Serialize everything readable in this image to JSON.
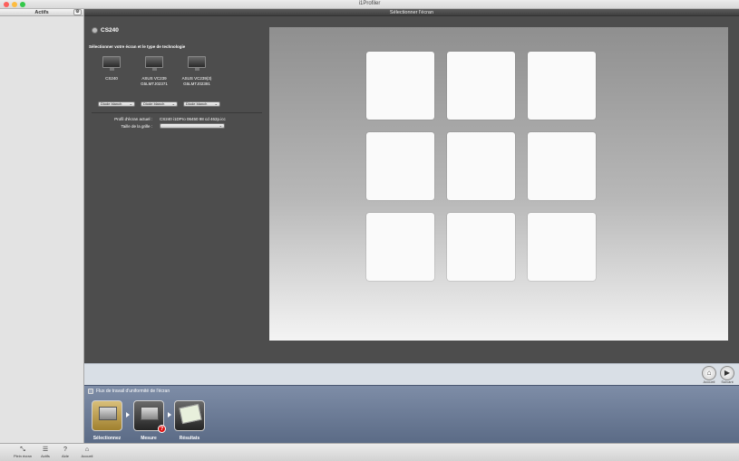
{
  "window": {
    "app_title": "i1Profiler"
  },
  "sidebar": {
    "header": "Actifs",
    "gear_icon": "⚙"
  },
  "panel": {
    "header": "Sélectionner l'écran",
    "display_title": "CS240",
    "choose_label": "Sélectionner votre écran et le type de technologie",
    "monitors": [
      {
        "name": "CS240",
        "sub": "",
        "tech": "Diode blanch"
      },
      {
        "name": "ASUS VC239",
        "sub": "G5LMTJ02371",
        "tech": "Diode blanch"
      },
      {
        "name": "ASUS VC239(3)",
        "sub": "G5LMTJ02391",
        "tech": "Diode blanch"
      }
    ],
    "profile_label": "Profil d'écran actuel :",
    "profile_value": "CS240 i1DPro 06450 98 cd 462p.icc",
    "grid_label": "Taille de la grille :",
    "grid_value": ""
  },
  "preview": {
    "tile_count": 9,
    "rows": 3,
    "cols": 3
  },
  "nav": {
    "home_label": "Accueil",
    "next_label": "Suivant"
  },
  "workflow": {
    "title": "Flux de travail d'uniformité de l'écran",
    "steps": [
      {
        "label": "Sélectionnez",
        "active": true
      },
      {
        "label": "Mesure",
        "active": false,
        "badge": "?"
      },
      {
        "label": "Résultats",
        "active": false
      }
    ]
  },
  "bottombar": {
    "tools": [
      {
        "label": "Plein écran",
        "icon": "⤡"
      },
      {
        "label": "Actifs",
        "icon": "☰"
      },
      {
        "label": "Aide",
        "icon": "?"
      },
      {
        "label": "Accueil",
        "icon": "⌂"
      }
    ]
  },
  "colors": {
    "accent_active_step": "#c6a85a",
    "alert_badge": "#dd1111"
  }
}
